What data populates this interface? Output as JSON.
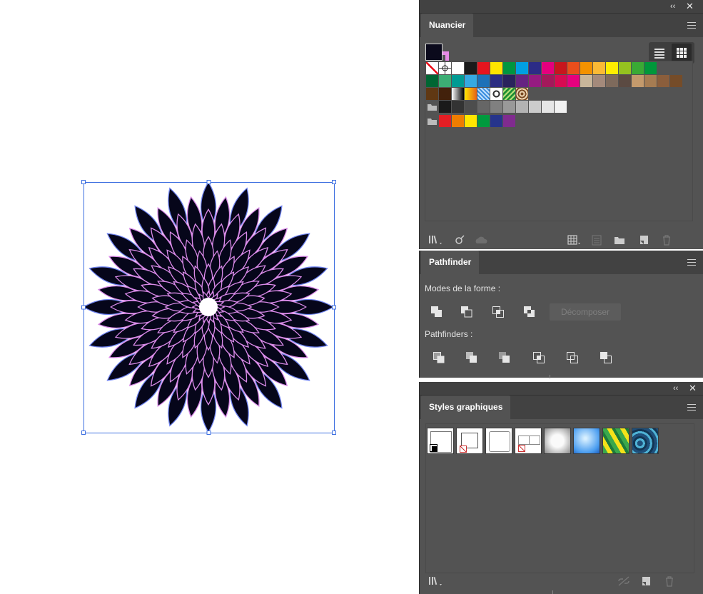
{
  "swatches_panel": {
    "title": "Nuancier",
    "fill_color": "#0b0a1c",
    "stroke_color": "#e68ae6",
    "row1": [
      "none",
      "registration",
      "#ffffff",
      "#1a1a1a",
      "#e5141e",
      "#ffe400",
      "#009640",
      "#00a0e1",
      "#2c2c86",
      "#e5007e",
      "#c8161d",
      "#e94e1b",
      "#f39200",
      "#fbba35",
      "#ffed00",
      "#95c11f",
      "#3aaa35",
      "#00983a"
    ],
    "row2": [
      "#006633",
      "#3cae74",
      "#009b93",
      "#36a9e1",
      "#1d71b8",
      "#2d2e83",
      "#29235c",
      "#662482",
      "#951b81",
      "#a3195b",
      "#d60b52",
      "#e6007e",
      "#c9b69a",
      "#a48a7b",
      "#7e6a5c",
      "#5b4a42",
      "#c49a6c",
      "#a67c52",
      "#8b5e3c",
      "#754c29"
    ],
    "row3": [
      "#603813",
      "#42210b",
      "gradient-bw",
      "gradient-orange",
      "pattern-blue",
      "pattern-dots",
      "pattern-leaf",
      "pattern-brown"
    ],
    "group_grays": [
      "#1a1a1a",
      "#333333",
      "#4d4d4d",
      "#666666",
      "#808080",
      "#999999",
      "#b3b3b3",
      "#cccccc",
      "#e6e6e6",
      "#f2f2f2"
    ],
    "group_brights": [
      "#e31e24",
      "#ef7d00",
      "#ffe600",
      "#009a3e",
      "#26348b",
      "#802b8f"
    ]
  },
  "pathfinder_panel": {
    "title": "Pathfinder",
    "shape_modes_label": "Modes de la forme :",
    "expand_label": "Décomposer",
    "pathfinders_label": "Pathfinders :"
  },
  "graphic_styles_panel": {
    "title": "Styles graphiques"
  }
}
